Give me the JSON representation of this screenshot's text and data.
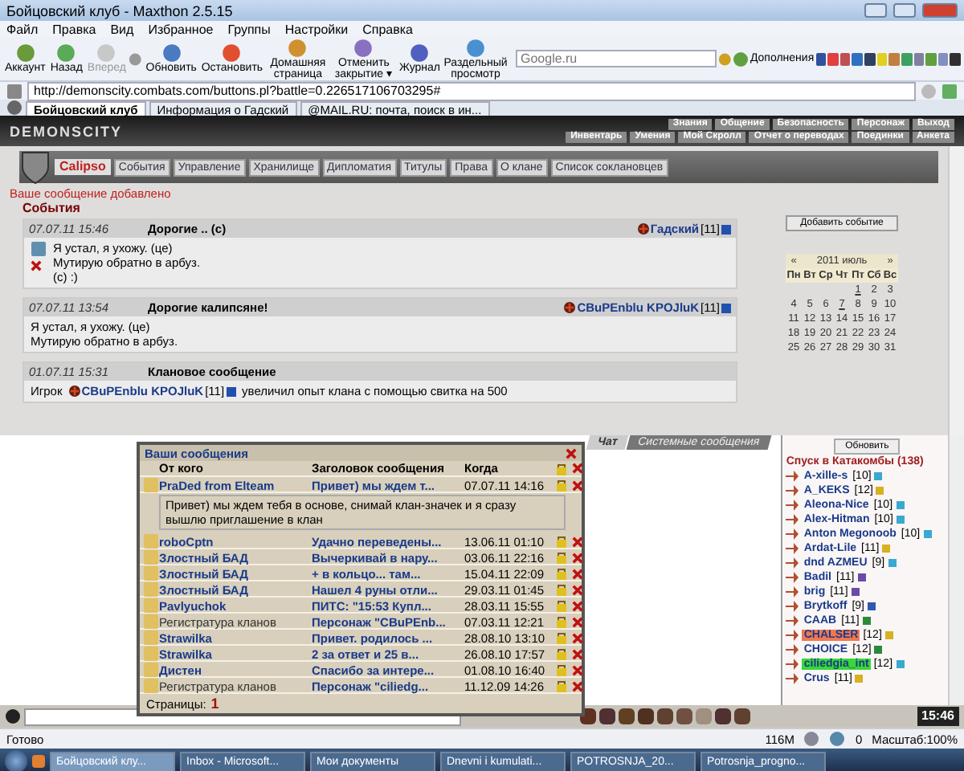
{
  "window": {
    "title": "Бойцовский клуб - Maxthon 2.5.15"
  },
  "menu": [
    "Файл",
    "Правка",
    "Вид",
    "Избранное",
    "Группы",
    "Настройки",
    "Справка"
  ],
  "toolbar": [
    {
      "label": "Аккаунт",
      "disabled": false
    },
    {
      "label": "Назад",
      "disabled": false
    },
    {
      "label": "Вперед",
      "disabled": true
    },
    {
      "label": "Обновить",
      "disabled": false
    },
    {
      "label": "Остановить",
      "disabled": false
    },
    {
      "label": "Домашняя страница",
      "disabled": false
    },
    {
      "label": "Отменить закрытие ▾",
      "disabled": false
    },
    {
      "label": "Журнал",
      "disabled": false
    },
    {
      "label": "Раздельный просмотр",
      "disabled": false
    }
  ],
  "search": {
    "placeholder": "Google.ru"
  },
  "addons_button": "Дополнения",
  "address": {
    "value": "http://demonscity.combats.com/buttons.pl?battle=0.226517106703295#"
  },
  "browser_tabs": [
    {
      "label": "Бойцовский клуб",
      "selected": true
    },
    {
      "label": "Информация о Гадский",
      "selected": false
    },
    {
      "label": "@MAIL.RU: почта, поиск в ин...",
      "selected": false
    }
  ],
  "game": {
    "logo": "DEMONSCITY",
    "top_menu": [
      "Знания",
      "Общение",
      "Безопасность",
      "Персонаж",
      "Выход"
    ],
    "sub_menu": [
      "Инвентарь",
      "Умения",
      "Мой Скролл",
      "Отчет о переводах",
      "Поединки",
      "Анкета"
    ]
  },
  "clan_nav": {
    "clan_name": "Calipso",
    "links": [
      "События",
      "Управление",
      "Хранилище",
      "Дипломатия",
      "Титулы",
      "Права",
      "О клане",
      "Список соклановцев"
    ]
  },
  "notice": "Ваше сообщение добавлено",
  "section_title": "События",
  "events": [
    {
      "kind": "post",
      "date": "07.07.11 15:46",
      "title": "Дорогие .. (с)",
      "author": "Гадский",
      "level": "[11]",
      "editable": true,
      "lines": [
        "Я устал, я ухожу. (це)",
        "Мутирую обратно в арбуз.",
        "(с) :)"
      ]
    },
    {
      "kind": "post",
      "date": "07.07.11 13:54",
      "title": "Дорогие калипсяне!",
      "author": "CBuPEnblu KPOJluK",
      "level": "[11]",
      "editable": false,
      "lines": [
        "Я устал, я ухожу. (це)",
        "Мутирую обратно в арбуз."
      ]
    },
    {
      "kind": "system",
      "date": "01.07.11 15:31",
      "title": "Клановое сообщение",
      "editable": false,
      "prefix": "Игрок",
      "author": "CBuPEnblu KPOJluK",
      "level": "[11]",
      "suffix": "увеличил опыт клана с помощью свитка на 500"
    }
  ],
  "calendar": {
    "add_button": "Добавить событие",
    "prev": "«",
    "month": "2011 июль",
    "next": "»",
    "weekdays": [
      "Пн",
      "Вт",
      "Ср",
      "Чт",
      "Пт",
      "Сб",
      "Вс"
    ],
    "weeks": [
      [
        {
          "day": "1",
          "event": true
        },
        {
          "day": "2",
          "event": false
        },
        {
          "day": "3",
          "event": false
        }
      ],
      [
        {
          "day": "4",
          "event": false
        },
        {
          "day": "5",
          "event": false
        },
        {
          "day": "6",
          "event": false
        },
        {
          "day": "7",
          "event": true
        },
        {
          "day": "8",
          "event": false
        },
        {
          "day": "9",
          "event": false
        },
        {
          "day": "10",
          "event": false
        }
      ],
      [
        {
          "day": "11",
          "event": false
        },
        {
          "day": "12",
          "event": false
        },
        {
          "day": "13",
          "event": false
        },
        {
          "day": "14",
          "event": false
        },
        {
          "day": "15",
          "event": false
        },
        {
          "day": "16",
          "event": false
        },
        {
          "day": "17",
          "event": false
        }
      ],
      [
        {
          "day": "18",
          "event": false
        },
        {
          "day": "19",
          "event": false
        },
        {
          "day": "20",
          "event": false
        },
        {
          "day": "21",
          "event": false
        },
        {
          "day": "22",
          "event": false
        },
        {
          "day": "23",
          "event": false
        },
        {
          "day": "24",
          "event": false
        }
      ],
      [
        {
          "day": "25",
          "event": false
        },
        {
          "day": "26",
          "event": false
        },
        {
          "day": "27",
          "event": false
        },
        {
          "day": "28",
          "event": false
        },
        {
          "day": "29",
          "event": false
        },
        {
          "day": "30",
          "event": false
        },
        {
          "day": "31",
          "event": false
        }
      ]
    ]
  },
  "chat_tabs": [
    {
      "label": "Чат",
      "selected": true
    },
    {
      "label": "Системные сообщения",
      "selected": false
    }
  ],
  "online": {
    "refresh_button": "Обновить",
    "room": "Спуск в Катакомбы (138)",
    "users": [
      {
        "name": "A-xille-s",
        "level": "[10]",
        "color": "#3aa8d0"
      },
      {
        "name": "A_KEKS",
        "level": "[12]",
        "color": "#d8b020"
      },
      {
        "name": "Aleona-Nice",
        "level": "[10]",
        "color": "#3aa8d0"
      },
      {
        "name": "Alex-Hitman",
        "level": "[10]",
        "color": "#3aa8d0"
      },
      {
        "name": "Anton Megonoob",
        "level": "[10]",
        "color": "#3aa8d0"
      },
      {
        "name": "Ardat-Lile",
        "level": "[11]",
        "color": "#d8b020"
      },
      {
        "name": "dnd AZMEU",
        "level": "[9]",
        "color": "#3aa8d0"
      },
      {
        "name": "Badil",
        "level": "[11]",
        "color": "#6a4aa8"
      },
      {
        "name": "brig",
        "level": "[11]",
        "color": "#6a4aa8"
      },
      {
        "name": "Brytkoff",
        "level": "[9]",
        "color": "#3058b0"
      },
      {
        "name": "CAAB",
        "level": "[11]",
        "color": "#2a8a3a"
      },
      {
        "name": "CHALSER",
        "level": "[12]",
        "color": "#d8b020",
        "highlight": {
          "color": "#f07850"
        }
      },
      {
        "name": "CHOICE",
        "level": "[12]",
        "color": "#2a8a3a"
      },
      {
        "name": "ciliedgia_int",
        "level": "[12]",
        "color": "#3aa8d0",
        "highlight": {
          "color": "#38d838"
        }
      },
      {
        "name": "Crus",
        "level": "[11]",
        "color": "#d8b020"
      }
    ]
  },
  "messages": {
    "title": "Ваши сообщения",
    "columns": [
      "От кого",
      "Заголовок сообщения",
      "Когда"
    ],
    "rows": [
      {
        "from": "PraDed from Elteam",
        "kind": "user",
        "subject": "Привет) мы ждем т...",
        "when": "07.07.11 14:16",
        "body": "Привет) мы ждем тебя в основе, снимай клан-значек и я сразу вышлю приглашение в клан"
      },
      {
        "from": "roboCptn",
        "kind": "user",
        "subject": "Удачно переведены...",
        "when": "13.06.11 01:10"
      },
      {
        "from": "Злостный БАД",
        "kind": "user",
        "subject": "Вычеркивай в нару...",
        "when": "03.06.11 22:16"
      },
      {
        "from": "Злостный БАД",
        "kind": "user",
        "subject": "+ в кольцо... там...",
        "when": "15.04.11 22:09"
      },
      {
        "from": "Злостный БАД",
        "kind": "user",
        "subject": "Нашел 4 руны отли...",
        "when": "29.03.11 01:45"
      },
      {
        "from": "Pavlyuchok",
        "kind": "user",
        "subject": "ПИТС: \"15:53 Купл...",
        "when": "28.03.11 15:55"
      },
      {
        "from": "Регистратура кланов",
        "kind": "system",
        "subject": "Персонаж \"CBuPEnb...",
        "when": "07.03.11 12:21"
      },
      {
        "from": "Strawilka",
        "kind": "user",
        "subject": "Привет. родилось ...",
        "when": "28.08.10 13:10"
      },
      {
        "from": "Strawilka",
        "kind": "user",
        "subject": "2 за ответ и 25 в...",
        "when": "26.08.10 17:57"
      },
      {
        "from": "Дистен",
        "kind": "user",
        "subject": "Спасибо за интере...",
        "when": "01.08.10 16:40"
      },
      {
        "from": "Регистратура кланов",
        "kind": "system",
        "subject": "Персонаж \"ciliedg...",
        "when": "11.12.09 14:26"
      }
    ],
    "pages_label": "Страницы:",
    "pages": [
      "1"
    ]
  },
  "clock": "15:46",
  "status_bar": {
    "text": "Готово",
    "memory": "116M",
    "count": "0",
    "zoom": "Масштаб:100%"
  },
  "taskbar": [
    {
      "label": "Бойцовский клу...",
      "selected": true
    },
    {
      "label": "Inbox - Microsoft...",
      "selected": false
    },
    {
      "label": "Мои документы",
      "selected": false
    },
    {
      "label": "Dnevni i kumulati...",
      "selected": false
    },
    {
      "label": "POTROSNJA_20...",
      "selected": false
    },
    {
      "label": "Potrosnja_progno...",
      "selected": false
    }
  ]
}
